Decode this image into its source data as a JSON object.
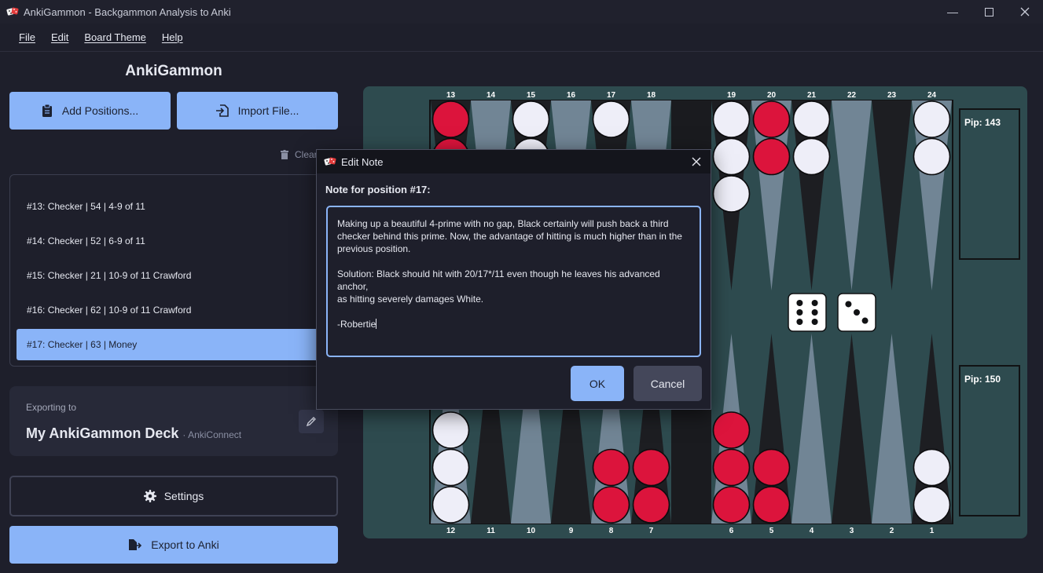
{
  "window": {
    "title": "AnkiGammon - Backgammon Analysis to Anki"
  },
  "menu": [
    "File",
    "Edit",
    "Board Theme",
    "Help"
  ],
  "sidebar": {
    "heading": "AnkiGammon",
    "add_positions_label": "Add Positions...",
    "import_file_label": "Import File...",
    "clear_label": "Clear",
    "positions": [
      {
        "label": "#13: Checker | 54 | 4-9 of 11",
        "selected": false
      },
      {
        "label": "#14: Checker | 52 | 6-9 of 11",
        "selected": false
      },
      {
        "label": "#15: Checker | 21 | 10-9 of 11 Crawford",
        "selected": false
      },
      {
        "label": "#16: Checker | 62 | 10-9 of 11 Crawford",
        "selected": false
      },
      {
        "label": "#17: Checker | 63 | Money",
        "selected": true
      }
    ],
    "export": {
      "label": "Exporting to",
      "deck_name": "My AnkiGammon Deck",
      "method": "· AnkiConnect"
    },
    "settings_label": "Settings",
    "export_button_label": "Export to Anki"
  },
  "board": {
    "top_point_numbers": [
      "13",
      "14",
      "15",
      "16",
      "17",
      "18",
      "19",
      "20",
      "21",
      "22",
      "23",
      "24"
    ],
    "bottom_point_numbers": [
      "12",
      "11",
      "10",
      "9",
      "8",
      "7",
      "6",
      "5",
      "4",
      "3",
      "2",
      "1"
    ],
    "pip_top": "Pip: 143",
    "pip_bottom": "Pip: 150",
    "dice": [
      6,
      3
    ],
    "checkers_top": [
      {
        "point": "13",
        "color": "red",
        "count": 2
      },
      {
        "point": "15",
        "color": "white",
        "count": 2
      },
      {
        "point": "17",
        "color": "white",
        "count": 1
      },
      {
        "point": "19",
        "color": "white",
        "count": 3
      },
      {
        "point": "20",
        "color": "red",
        "count": 2
      },
      {
        "point": "21",
        "color": "white",
        "count": 2
      },
      {
        "point": "24",
        "color": "white",
        "count": 2
      }
    ],
    "checkers_bottom": [
      {
        "point": "12",
        "color": "white",
        "count": 3
      },
      {
        "point": "8",
        "color": "red",
        "count": 2
      },
      {
        "point": "7",
        "color": "red",
        "count": 2
      },
      {
        "point": "6",
        "color": "red",
        "count": 3
      },
      {
        "point": "5",
        "color": "red",
        "count": 2
      },
      {
        "point": "1",
        "color": "white",
        "count": 2
      }
    ],
    "colors": {
      "frame": "#2e4b4f",
      "red_checker": "#dc143c",
      "white_checker": "#eeeef8",
      "dark_point": "#1d1e22",
      "light_point": "#718595"
    }
  },
  "dialog": {
    "title": "Edit Note",
    "label": "Note for position #17:",
    "note_text": "Making up a beautiful 4-prime with no gap, Black certainly will push back a third\nchecker behind this prime. Now, the advantage of hitting is much higher than in the\nprevious position.\n\nSolution: Black should hit with 20/17*/11 even though he leaves his advanced anchor,\nas hitting severely damages White.\n\n-Robertie",
    "ok_label": "OK",
    "cancel_label": "Cancel"
  },
  "colors": {
    "accent": "#8ab4f8",
    "background": "#1e1f2b"
  }
}
